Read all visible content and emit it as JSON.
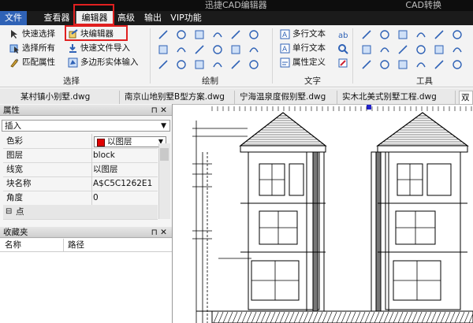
{
  "app": {
    "title": "迅捷CAD编辑器",
    "right_text": "CAD转换"
  },
  "menu": {
    "file": "文件",
    "viewer": "查看器",
    "editor": "编辑器",
    "advanced": "高级",
    "output": "输出",
    "vip": "VIP功能"
  },
  "ribbon": {
    "select": {
      "quick_select": "快速选择",
      "select_all": "选择所有",
      "match_props": "匹配属性",
      "block_editor": "块编辑器",
      "quick_import": "快速文件导入",
      "polygon_input": "多边形实体输入",
      "label": "选择"
    },
    "draw": {
      "label": "绘制"
    },
    "text": {
      "mtext": "多行文本",
      "stext": "单行文本",
      "attdef": "属性定义",
      "label": "文字"
    },
    "tools": {
      "label": "工具"
    }
  },
  "doc_tabs": [
    "某村镇小别墅.dwg",
    "南京山地别墅B型方案.dwg",
    "宁海温泉度假别墅.dwg",
    "实木北美式别墅工程.dwg",
    "双"
  ],
  "properties": {
    "header": "属性",
    "type": "插入",
    "rows": [
      {
        "key": "色彩",
        "value": "以图层"
      },
      {
        "key": "图层",
        "value": "block"
      },
      {
        "key": "线宽",
        "value": "以图层"
      },
      {
        "key": "块名称",
        "value": "A$C5C1262E1"
      },
      {
        "key": "角度",
        "value": "0"
      }
    ],
    "point_section": "点"
  },
  "favorites": {
    "header": "收藏夹",
    "col_name": "名称",
    "col_path": "路径"
  },
  "colors": {
    "highlight": "#e02020",
    "file_tab": "#2f62b6",
    "menubar": "#1b1b1b"
  }
}
